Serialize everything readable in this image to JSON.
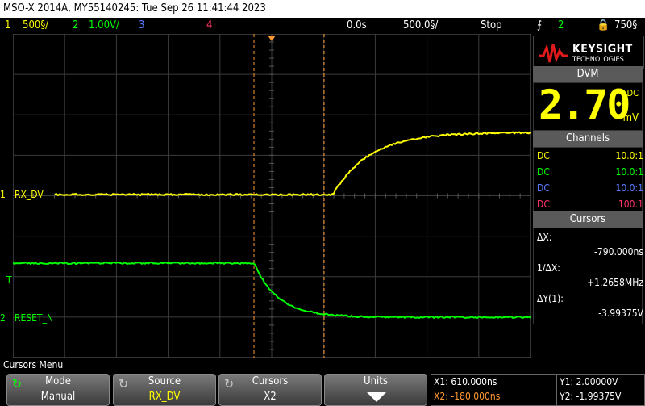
{
  "title": "MSO-X 2014A, MY55140245: Tue Sep 26 11:41:44 2023",
  "status": {
    "ch1_num": "1",
    "ch1_scale": "500§/",
    "ch2_num": "2",
    "ch2_scale": "1.00V/",
    "ch3_num": "3",
    "ch4_num": "4",
    "delay": "0.0s",
    "timebase": "500.0§/",
    "run_state": "Stop",
    "trigger_source": "2",
    "trigger_level": "750§"
  },
  "logo": {
    "line1": "KEYSIGHT",
    "line2": "TECHNOLOGIES"
  },
  "dvm": {
    "header": "DVM",
    "value": "2.70",
    "mode": "DC",
    "unit": "mV"
  },
  "channels": {
    "header": "Channels",
    "rows": [
      {
        "coupling": "DC",
        "probe": "10.0:1",
        "color": "#ffff00"
      },
      {
        "coupling": "DC",
        "probe": "10.0:1",
        "color": "#00ff00"
      },
      {
        "coupling": "DC",
        "probe": "10.0:1",
        "color": "#5a7bff"
      },
      {
        "coupling": "DC",
        "probe": "100:1",
        "color": "#ff3366"
      }
    ]
  },
  "cursors": {
    "header": "Cursors",
    "dx_label": "ΔX:",
    "dx_value": "-790.000ns",
    "inv_dx_label": "1/ΔX:",
    "inv_dx_value": "+1.2658MHz",
    "dy_label": "ΔY(1):",
    "dy_value": "-3.99375V"
  },
  "traces": {
    "ch1_label": "RX_DV",
    "ch2_label": "RESET_N",
    "ch1_marker": "1",
    "ch2_marker": "2",
    "trigger_marker": "T"
  },
  "menu": {
    "title": "Cursors Menu",
    "softkeys": [
      {
        "label": "Mode",
        "value": "Manual"
      },
      {
        "label": "Source",
        "value": "RX_DV"
      },
      {
        "label": "Cursors",
        "value": "X2"
      },
      {
        "label": "Units",
        "value": ""
      }
    ]
  },
  "readouts": {
    "x1": "X1: 610.000ns",
    "x2": "X2: -180.000ns",
    "y1": "Y1: 2.00000V",
    "y2": "Y2: -1.99375V"
  },
  "colors": {
    "ch1": "#ffff00",
    "ch2": "#00ff00",
    "ch3": "#5a7bff",
    "ch4": "#ff3366",
    "cursor": "#ff9933"
  }
}
